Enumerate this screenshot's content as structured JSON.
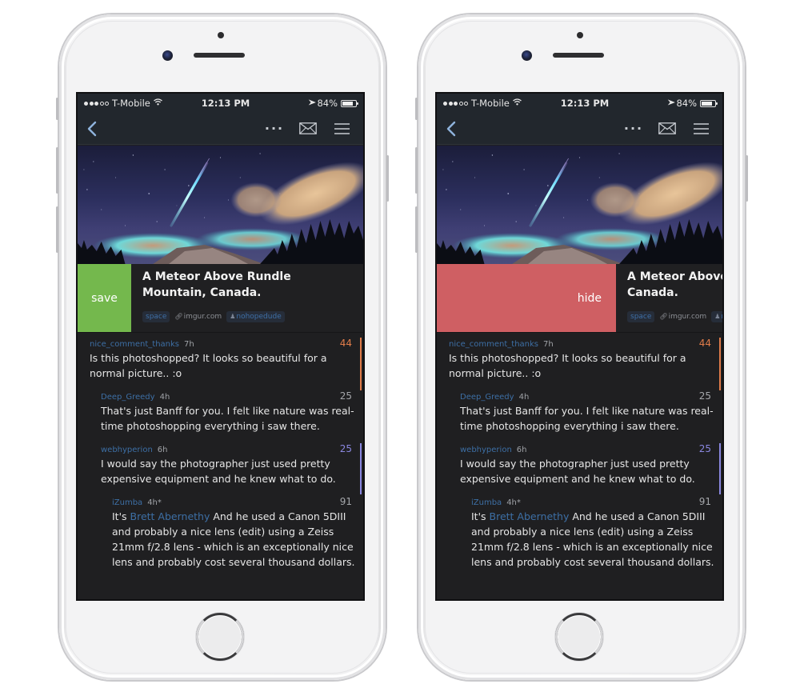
{
  "status_bar": {
    "carrier": "T-Mobile",
    "signal_bars_filled": 3,
    "signal_bars_total": 5,
    "time": "12:13 PM",
    "battery": "84%",
    "battery_level": 0.84
  },
  "nav": {
    "back_icon": "chevron-left-icon",
    "more_icon": "ellipsis-icon",
    "more_label": "···",
    "mail_icon": "envelope-icon",
    "menu_icon": "hamburger-icon"
  },
  "post": {
    "title": "A Meteor Above Rundle Mountain, Canada.",
    "subreddit": "space",
    "domain": "imgur.com",
    "author": "nohopedude",
    "image_alt": "Meteor streaking over a mountain at night with clouds and pine trees"
  },
  "swipe_actions": {
    "left": {
      "label": "save",
      "color": "#74b84d"
    },
    "right": {
      "label": "hide",
      "color": "#cf5f63"
    }
  },
  "comments": [
    {
      "user": "nice_comment_thanks",
      "age": "7h",
      "score": "44",
      "score_color": "#e07c4a",
      "bar_color": "#e07c4a",
      "text": "Is this photoshopped? It looks so beautiful for a normal picture.. :o",
      "depth": 0
    },
    {
      "user": "Deep_Greedy",
      "age": "4h",
      "score": "25",
      "score_color": "#a5a7ab",
      "text": "That's just Banff for you. I felt like nature was real-time photoshopping everything i saw there.",
      "depth": 1
    },
    {
      "user": "webhyperion",
      "age": "6h",
      "score": "25",
      "score_color": "#8a87e0",
      "bar_color": "#8a87e0",
      "text": "I would say the photographer just used pretty expensive equipment and he knew what to do.",
      "depth": 1
    },
    {
      "user": "iZumba",
      "age": "4h*",
      "score": "91",
      "score_color": "#a5a7ab",
      "text_prefix": "It's ",
      "link_text": "Brett Abernethy",
      "text": " And he used a Canon 5DIII and probably a nice lens (edit) using a Zeiss 21mm f/2.8 lens - which is an exceptionally nice lens and probably cost several thousand dollars.",
      "depth": 2
    }
  ]
}
